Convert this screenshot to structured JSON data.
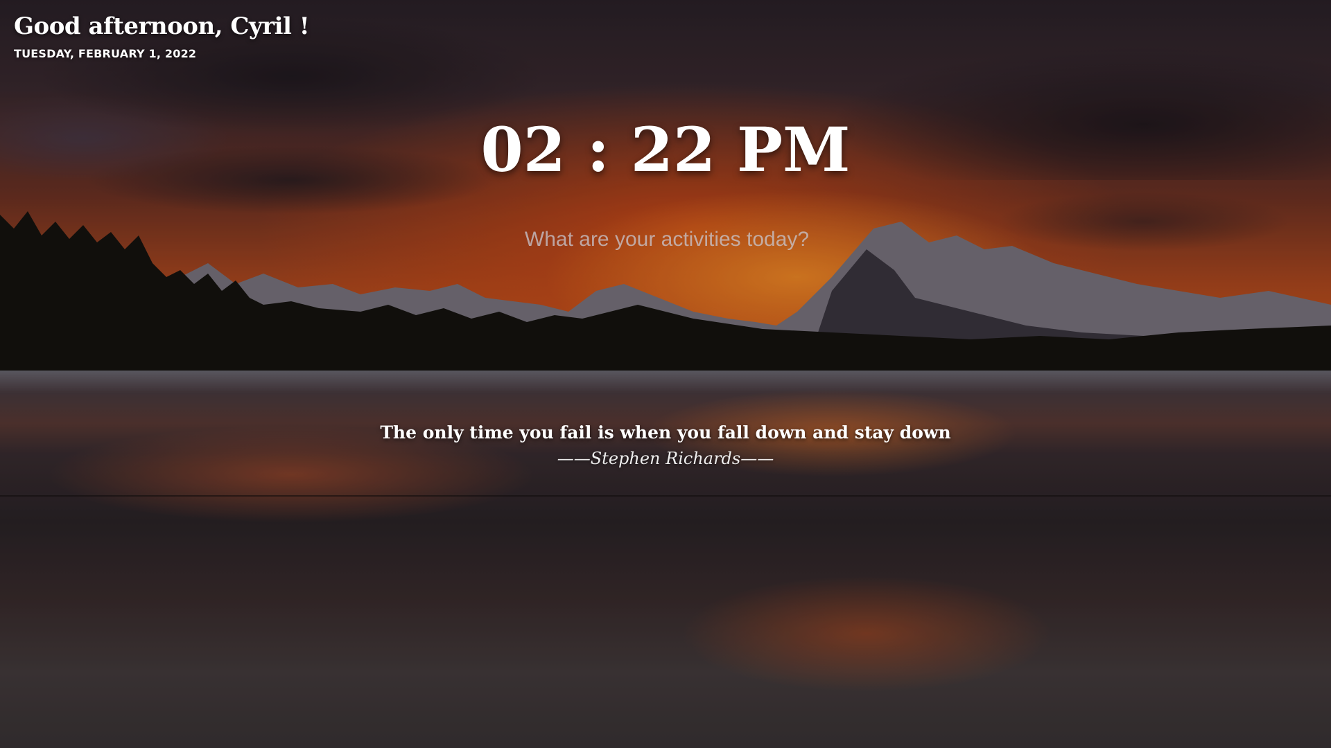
{
  "greeting": {
    "text": "Good afternoon, Cyril !"
  },
  "date": {
    "text": "TUESDAY, FEBRUARY 1, 2022"
  },
  "clock": {
    "time": "02 : 22 PM"
  },
  "activity": {
    "placeholder": "What are your activities today?",
    "value": ""
  },
  "quote": {
    "text": "The only time you fail is when you fall down and stay down",
    "author": "——Stephen Richards——"
  },
  "background": {
    "scene": "sunset over mountain lake",
    "accent_color": "#c9561d"
  }
}
